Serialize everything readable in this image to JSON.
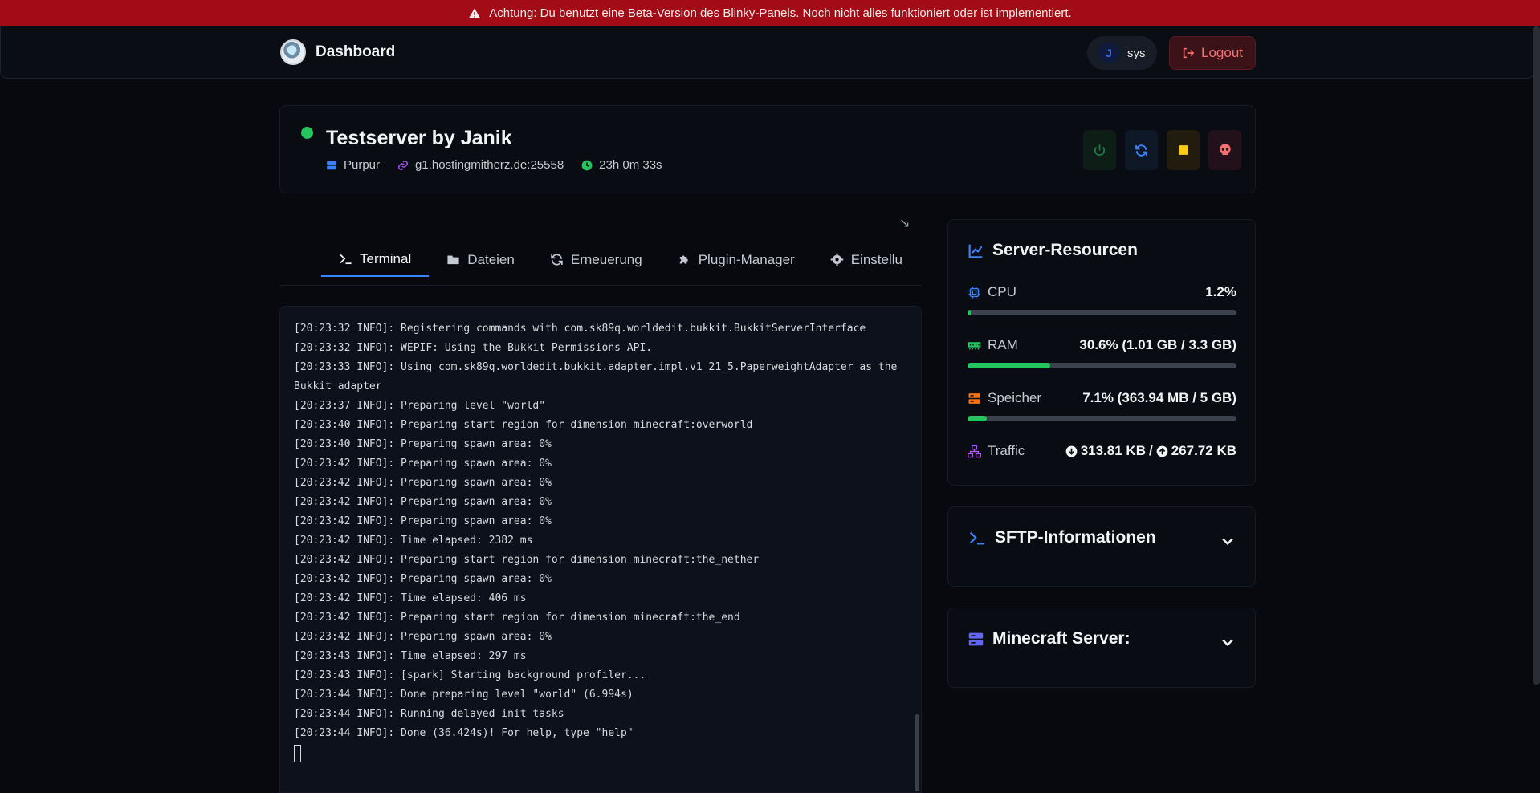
{
  "banner": {
    "text": "Achtung: Du benutzt eine Beta-Version des Blinky-Panels. Noch nicht alles funktioniert oder ist implementiert.",
    "icon": "warning-icon"
  },
  "navbar": {
    "title": "Dashboard",
    "user": {
      "avatar_text": "J",
      "name": "sys"
    },
    "logout_label": "Logout"
  },
  "server": {
    "name": "Testserver by Janik",
    "status_color": "#22c55e",
    "software": "Purpur",
    "address": "g1.hostingmitherz.de:25558",
    "uptime": "23h 0m 33s"
  },
  "tabs": [
    {
      "label": "Terminal",
      "icon": "terminal-icon",
      "active": true
    },
    {
      "label": "Dateien",
      "icon": "folder-icon",
      "active": false
    },
    {
      "label": "Erneuerung",
      "icon": "refresh-icon",
      "active": false
    },
    {
      "label": "Plugin-Manager",
      "icon": "puzzle-icon",
      "active": false
    },
    {
      "label": "Einstellu",
      "icon": "gear-icon",
      "active": false
    }
  ],
  "terminal": {
    "lines": [
      "[20:23:32 INFO]: Registering commands with com.sk89q.worldedit.bukkit.BukkitServerInterface",
      "[20:23:32 INFO]: WEPIF: Using the Bukkit Permissions API.",
      "[20:23:33 INFO]: Using com.sk89q.worldedit.bukkit.adapter.impl.v1_21_5.PaperweightAdapter as the Bukkit adapter",
      "[20:23:37 INFO]: Preparing level \"world\"",
      "[20:23:40 INFO]: Preparing start region for dimension minecraft:overworld",
      "[20:23:40 INFO]: Preparing spawn area: 0%",
      "[20:23:42 INFO]: Preparing spawn area: 0%",
      "[20:23:42 INFO]: Preparing spawn area: 0%",
      "[20:23:42 INFO]: Preparing spawn area: 0%",
      "[20:23:42 INFO]: Preparing spawn area: 0%",
      "[20:23:42 INFO]: Time elapsed: 2382 ms",
      "[20:23:42 INFO]: Preparing start region for dimension minecraft:the_nether",
      "[20:23:42 INFO]: Preparing spawn area: 0%",
      "[20:23:42 INFO]: Time elapsed: 406 ms",
      "[20:23:42 INFO]: Preparing start region for dimension minecraft:the_end",
      "[20:23:42 INFO]: Preparing spawn area: 0%",
      "[20:23:43 INFO]: Time elapsed: 297 ms",
      "[20:23:43 INFO]: [spark] Starting background profiler...",
      "[20:23:44 INFO]: Done preparing level \"world\" (6.994s)",
      "[20:23:44 INFO]: Running delayed init tasks",
      "[20:23:44 INFO]: Done (36.424s)! For help, type \"help\""
    ]
  },
  "resources": {
    "title": "Server-Resourcen",
    "cpu": {
      "label": "CPU",
      "value": "1.2%",
      "percent": 1.2
    },
    "ram": {
      "label": "RAM",
      "value": "30.6% (1.01 GB / 3.3 GB)",
      "percent": 30.6
    },
    "storage": {
      "label": "Speicher",
      "value": "7.1% (363.94 MB / 5 GB)",
      "percent": 7.1
    },
    "traffic": {
      "label": "Traffic",
      "down": "313.81 KB",
      "separator": "/",
      "up": "267.72 KB"
    }
  },
  "sftp": {
    "title": "SFTP-Informationen"
  },
  "minecraft": {
    "title": "Minecraft Server:"
  },
  "colors": {
    "accent": "#3b82f6",
    "success": "#22c55e",
    "danger": "#f87171",
    "warning": "#facc15",
    "banner": "#a30b16"
  }
}
